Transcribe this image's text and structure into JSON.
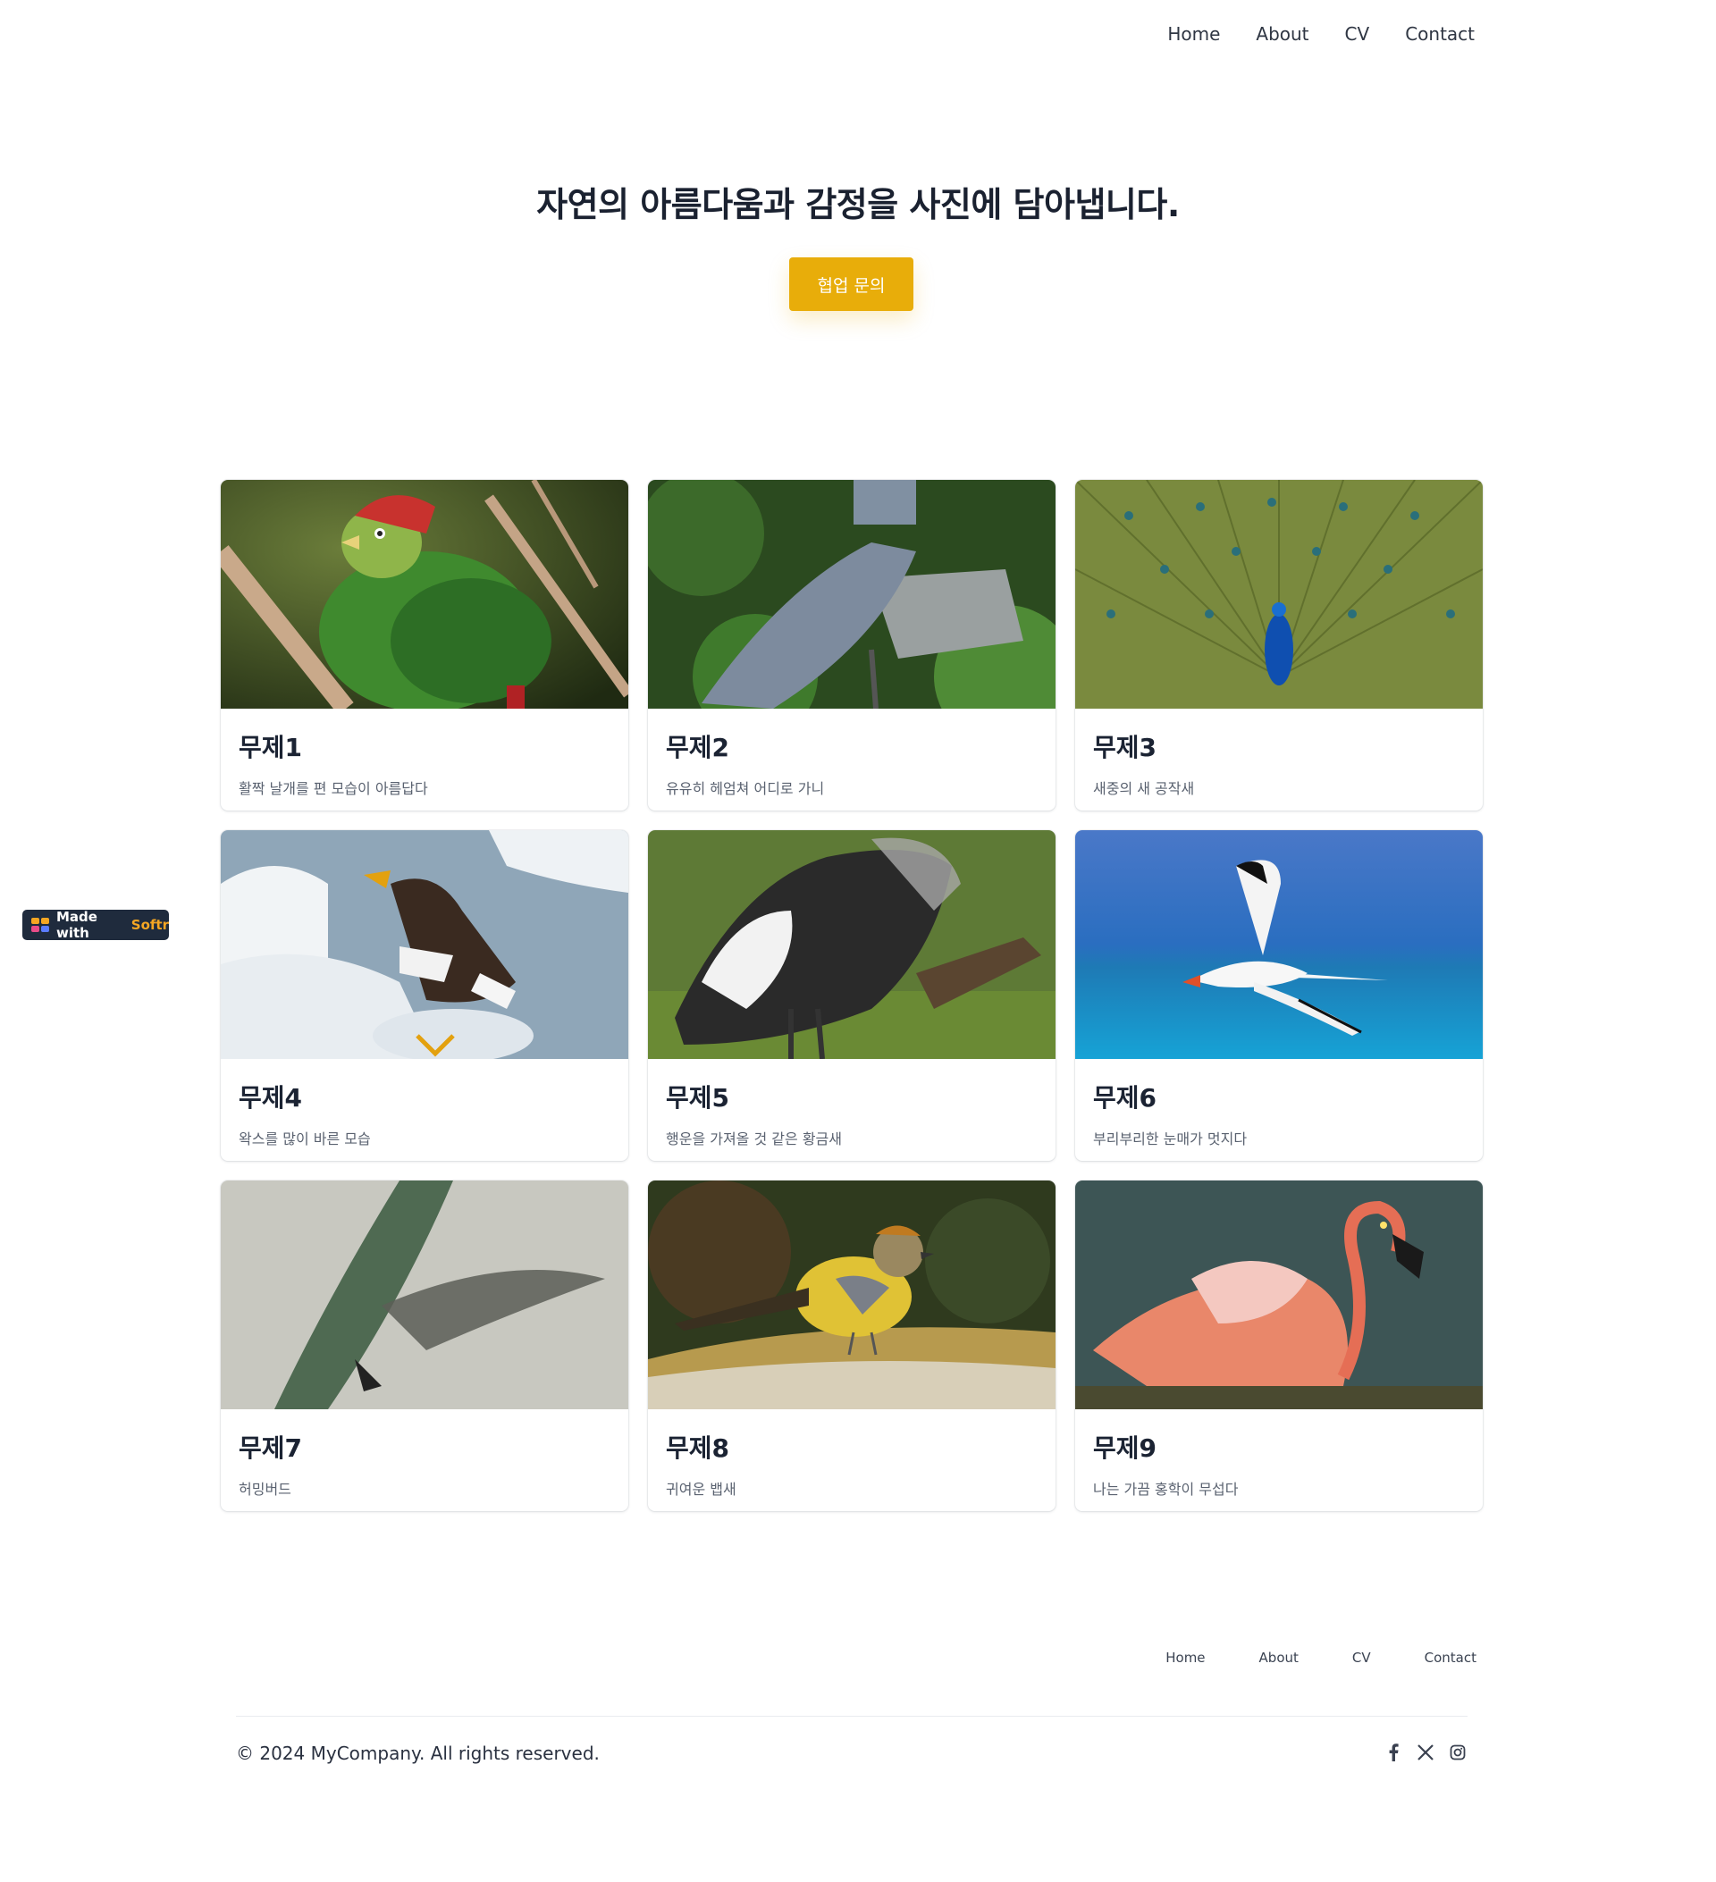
{
  "nav": {
    "items": [
      "Home",
      "About",
      "CV",
      "Contact"
    ]
  },
  "hero": {
    "title": "자연의 아름다움과 감정을 사진에 담아냅니다.",
    "cta_label": "협업 문의"
  },
  "badge": {
    "prefix": "Made with",
    "brand": "Softr"
  },
  "cards": [
    {
      "title": "무제1",
      "description": "활짝 날개를 편 모습이 아름답다",
      "image": "red-crested turaco on branch"
    },
    {
      "title": "무제2",
      "description": "유유히 헤엄쳐 어디로 가니",
      "image": "shoebill among plants"
    },
    {
      "title": "무제3",
      "description": "새중의 새 공작새",
      "image": "peacock with fanned tail"
    },
    {
      "title": "무제4",
      "description": "왁스를 많이 바른 모습",
      "image": "sea eagle on ice"
    },
    {
      "title": "무제5",
      "description": "행운을 가져올 것 같은 황금새",
      "image": "crowned crane"
    },
    {
      "title": "무제6",
      "description": "부리부리한 눈매가 멋지다",
      "image": "tropicbird over sea"
    },
    {
      "title": "무제7",
      "description": "허밍버드",
      "image": "hummingbird in flight"
    },
    {
      "title": "무제8",
      "description": "귀여운 뱁새",
      "image": "small yellow bird on log"
    },
    {
      "title": "무제9",
      "description": "나는 가끔 홍학이 무섭다",
      "image": "flamingo in water"
    }
  ],
  "footer": {
    "nav": [
      "Home",
      "About",
      "CV",
      "Contact"
    ],
    "copyright": "© 2024 MyCompany. All rights reserved.",
    "social": [
      "facebook-icon",
      "x-icon",
      "instagram-icon"
    ]
  },
  "colors": {
    "accent": "#e8ad0a",
    "badge_bg": "#1f2b3d",
    "text": "#1b2333"
  }
}
